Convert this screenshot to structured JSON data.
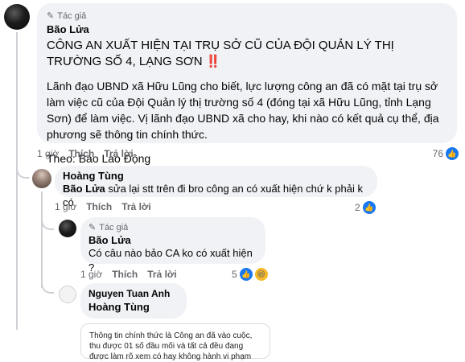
{
  "comment1": {
    "badge": "Tác giả",
    "author": "Bão Lửa",
    "headline": "CÔNG AN XUẤT HIỆN TẠI TRỤ SỞ CŨ CỦA ĐỘI QUẢN LÝ THỊ TRƯỜNG SỐ 4, LẠNG SƠN",
    "headline_emoji": "‼️",
    "paragraph": "Lãnh đạo UBND xã Hữu Lũng cho biết, lực lượng công an đã có mặt tại trụ sở làm việc cũ của Đội Quản lý thị trường số 4 (đóng tại xã Hữu Lũng, tỉnh Lạng Sơn) để làm việc. Vị lãnh đạo UBND xã cho hay, khi nào có kết quả cụ thể, địa phương sẽ thông tin chính thức.",
    "source": "Theo: Báo Lao Động",
    "time": "1 giờ",
    "like_label": "Thích",
    "reply_label": "Trả lời",
    "reaction_count": "76"
  },
  "comment2": {
    "author": "Hoàng Tùng",
    "mention": "Bão Lửa",
    "text": " sửa lại stt trên đi bro công an có xuất hiện chứ k phải k có",
    "time": "1 giờ",
    "like_label": "Thích",
    "reply_label": "Trả lời",
    "reaction_count": "2"
  },
  "comment3": {
    "badge": "Tác giả",
    "author": "Bão Lửa",
    "text": "Có câu nào bảo CA ko có xuất hiện ?",
    "time": "1 giờ",
    "like_label": "Thích",
    "reply_label": "Trả lời",
    "reaction_count": "5"
  },
  "comment4": {
    "author": "Nguyen Tuan Anh",
    "mention": "Hoàng Tùng",
    "image_text": "Thông tin chính thức là Công an đã vào cuộc, thu được 01 số đầu mối và tất cả đều đang được làm rõ xem có hay không hành vi phạm tội và chứng cứ phạm tội."
  },
  "icons": {
    "badge": "pen-icon",
    "like": "thumbs-up-icon",
    "haha": "laughing-face-icon"
  },
  "colors": {
    "bubble": "#f0f2f5",
    "like_blue": "#1877f2",
    "secondary_text": "#65676b",
    "alert_red": "#e41e3f"
  }
}
